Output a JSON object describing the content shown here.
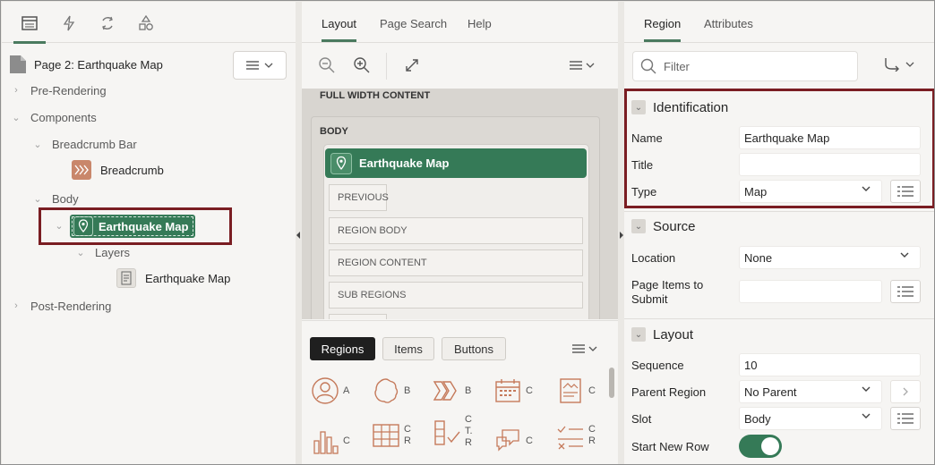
{
  "left": {
    "tabs": [
      "rendering-tree-icon",
      "dynamic-actions-icon",
      "processing-icon",
      "shared-components-icon"
    ],
    "page_title": "Page 2: Earthquake Map",
    "tree": {
      "pre_rendering": "Pre-Rendering",
      "components": "Components",
      "breadcrumb_bar": "Breadcrumb Bar",
      "breadcrumb": "Breadcrumb",
      "body": "Body",
      "earthquake_map": "Earthquake Map",
      "layers": "Layers",
      "layer_item": "Earthquake Map",
      "post_rendering": "Post-Rendering"
    }
  },
  "middle": {
    "tabs": {
      "layout": "Layout",
      "page_search": "Page Search",
      "help": "Help"
    },
    "canvas": {
      "full_width": "FULL WIDTH CONTENT",
      "body": "BODY",
      "region_title": "Earthquake Map",
      "slots": [
        "PREVIOUS",
        "REGION BODY",
        "REGION CONTENT",
        "SUB REGIONS"
      ]
    },
    "gallery": {
      "tabs": {
        "regions": "Regions",
        "items": "Items",
        "buttons": "Buttons"
      },
      "row1": [
        "A",
        "B",
        "B",
        "C",
        "C"
      ],
      "row2": [
        "C",
        "C\nR",
        "C\nT.\nR",
        "C",
        "C\nR"
      ]
    }
  },
  "right": {
    "tabs": {
      "region": "Region",
      "attributes": "Attributes"
    },
    "filter_placeholder": "Filter",
    "identification": {
      "header": "Identification",
      "name_label": "Name",
      "name_value": "Earthquake Map",
      "title_label": "Title",
      "title_value": "",
      "type_label": "Type",
      "type_value": "Map"
    },
    "source": {
      "header": "Source",
      "location_label": "Location",
      "location_value": "None",
      "page_items_label": "Page Items to\nSubmit",
      "page_items_value": ""
    },
    "layout": {
      "header": "Layout",
      "sequence_label": "Sequence",
      "sequence_value": "10",
      "parent_label": "Parent Region",
      "parent_value": "No Parent",
      "slot_label": "Slot",
      "slot_value": "Body",
      "new_row_label": "Start New Row"
    }
  },
  "colors": {
    "accent": "#357a57",
    "highlight": "#7a1d22",
    "icon_accent": "#c57a5b"
  }
}
